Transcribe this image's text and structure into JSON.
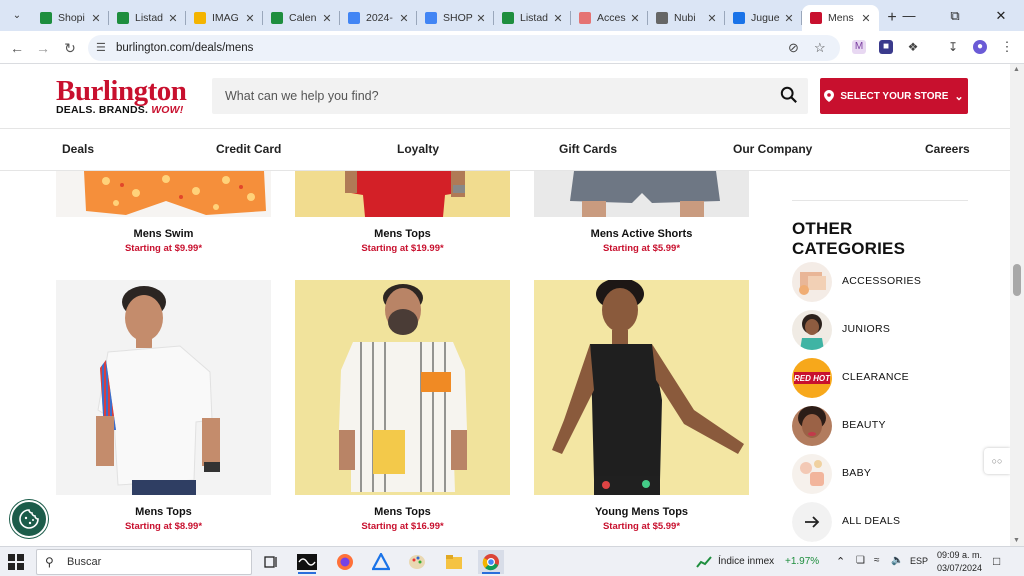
{
  "browser": {
    "tabs": [
      {
        "label": "Shopi",
        "favicon": "sheets-icon",
        "color": "#1e8e3e"
      },
      {
        "label": "Listad",
        "favicon": "sheets-icon",
        "color": "#1e8e3e"
      },
      {
        "label": "IMAG",
        "favicon": "drive-icon",
        "color": "#f4b400"
      },
      {
        "label": "Calen",
        "favicon": "sheets-icon",
        "color": "#1e8e3e"
      },
      {
        "label": "2024-",
        "favicon": "docs-icon",
        "color": "#4285f4"
      },
      {
        "label": "SHOP",
        "favicon": "docs-icon",
        "color": "#4285f4"
      },
      {
        "label": "Listad",
        "favicon": "sheets-icon",
        "color": "#1e8e3e"
      },
      {
        "label": "Acces",
        "favicon": "gear-icon",
        "color": "#e57373"
      },
      {
        "label": "Nubi",
        "favicon": "nubi-icon",
        "color": "#666666"
      },
      {
        "label": "Jugue",
        "favicon": "forms-icon",
        "color": "#1a73e8"
      },
      {
        "label": "Mens",
        "favicon": "burlington-icon",
        "color": "#c8102e"
      }
    ],
    "url": "burlington.com/deals/mens"
  },
  "header": {
    "logo_word": "Burlington",
    "logo_tag": "DEALS. BRANDS.",
    "logo_wow": "WOW!",
    "search_placeholder": "What can we help you find?",
    "store_button": "SELECT YOUR STORE"
  },
  "nav": [
    "Deals",
    "Credit Card",
    "Loyalty",
    "Gift Cards",
    "Our Company",
    "Careers"
  ],
  "products_top": [
    {
      "name": "Mens Swim",
      "price": "Starting at $9.99*"
    },
    {
      "name": "Mens Tops",
      "price": "Starting at $19.99*"
    },
    {
      "name": "Mens Active Shorts",
      "price": "Starting at $5.99*"
    }
  ],
  "products_bottom": [
    {
      "name": "Mens Tops",
      "price": "Starting at $8.99*"
    },
    {
      "name": "Mens Tops",
      "price": "Starting at $16.99*"
    },
    {
      "name": "Young Mens Tops",
      "price": "Starting at $5.99*"
    }
  ],
  "sidebar": {
    "title": "OTHER CATEGORIES",
    "items": [
      {
        "label": "ACCESSORIES"
      },
      {
        "label": "JUNIORS"
      },
      {
        "label": "CLEARANCE",
        "badge": "RED HOT"
      },
      {
        "label": "BEAUTY"
      },
      {
        "label": "BABY"
      },
      {
        "label": "ALL DEALS"
      }
    ]
  },
  "taskbar": {
    "search": "Buscar",
    "stock_name": "Índice inmex",
    "stock_change": "+1.97%",
    "lang": "ESP",
    "time": "09:09 a. m.",
    "date": "03/07/2024"
  },
  "colors": {
    "brand": "#c8102e",
    "stock_up": "#1e8e3e"
  }
}
